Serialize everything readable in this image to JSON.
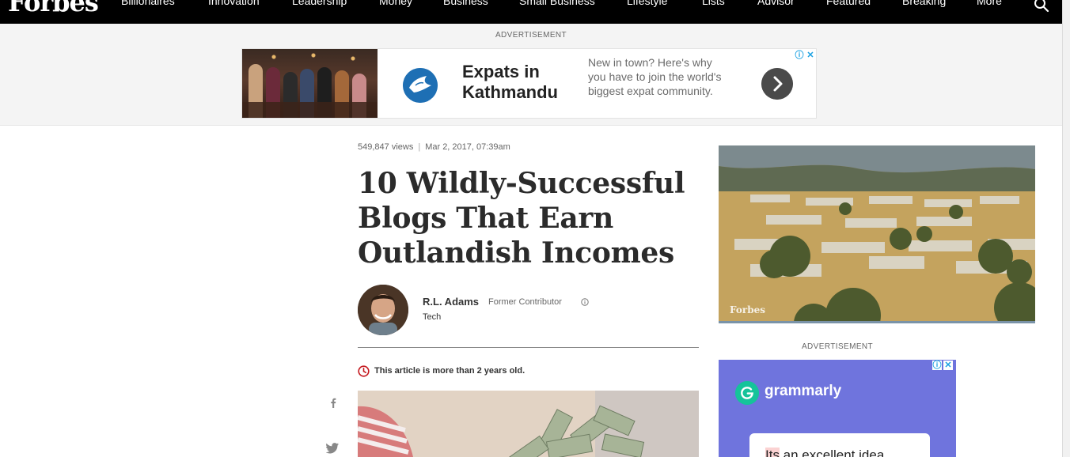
{
  "nav": {
    "logo": "Forbes",
    "items": [
      "Billionaires",
      "Innovation",
      "Leadership",
      "Money",
      "Business",
      "Small Business",
      "Lifestyle",
      "Lists",
      "Advisor",
      "Featured",
      "Breaking",
      "More"
    ],
    "search_icon": "search-icon"
  },
  "top_ad": {
    "label": "ADVERTISEMENT",
    "title": "Expats in Kathmandu",
    "text": "New in town? Here's why you have to join the world's biggest expat community.",
    "arrow_icon": "chevron-right-icon",
    "adchoices_icon": "info-icon",
    "close_icon": "close-icon"
  },
  "article": {
    "views": "549,847 views",
    "separator": "|",
    "date": "Mar 2, 2017, 07:39am",
    "title": "10 Wildly-Successful Blogs That Earn Outlandish Incomes",
    "author": {
      "name": "R.L. Adams",
      "role": "Former Contributor",
      "info_icon": "info-icon",
      "tag": "Tech"
    },
    "old_notice": "This article is more than 2 years old.",
    "old_icon": "clock-icon"
  },
  "share": {
    "facebook_icon": "facebook-icon",
    "twitter_icon": "twitter-icon"
  },
  "right_rail": {
    "video_brand": "Forbes",
    "ad_label": "ADVERTISEMENT",
    "ad": {
      "brand": "grammarly",
      "card_text_highlight": "Its",
      "card_text_rest": " an excellent idea"
    }
  },
  "colors": {
    "nav_bg": "#000000",
    "accent_red": "#c4171d",
    "grammarly_bg": "#6f74dd",
    "grammarly_green": "#15c39a"
  }
}
